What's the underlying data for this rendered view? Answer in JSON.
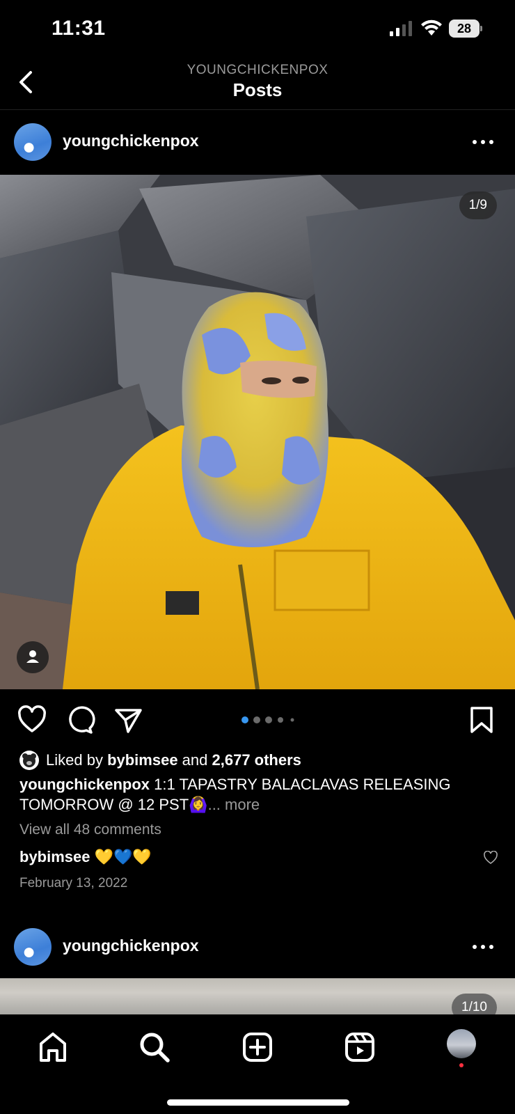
{
  "status_bar": {
    "time": "11:31",
    "battery": "28"
  },
  "header": {
    "subtitle": "YOUNGCHICKENPOX",
    "title": "Posts"
  },
  "post": {
    "username": "youngchickenpox",
    "image_counter": "1/9",
    "likes": {
      "prefix": "Liked by ",
      "user": "bybimsee",
      "middle": " and ",
      "count": "2,677 others"
    },
    "caption": {
      "username": "youngchickenpox",
      "text": " 1:1 TAPASTRY BALACLAVAS RELEASING TOMORROW @ 12 PST🙆‍♀️",
      "more": "... more"
    },
    "view_comments": "View all 48 comments",
    "top_comment": {
      "username": "bybimsee",
      "text": "💛💙💛"
    },
    "date": "February 13, 2022",
    "carousel": {
      "total_dots": 5,
      "active_index": 0
    }
  },
  "next_post": {
    "username": "youngchickenpox",
    "image_counter": "1/10"
  },
  "tab_bar": {
    "items": [
      "home-icon",
      "search-icon",
      "create-post-icon",
      "reels-icon",
      "profile-avatar"
    ]
  }
}
